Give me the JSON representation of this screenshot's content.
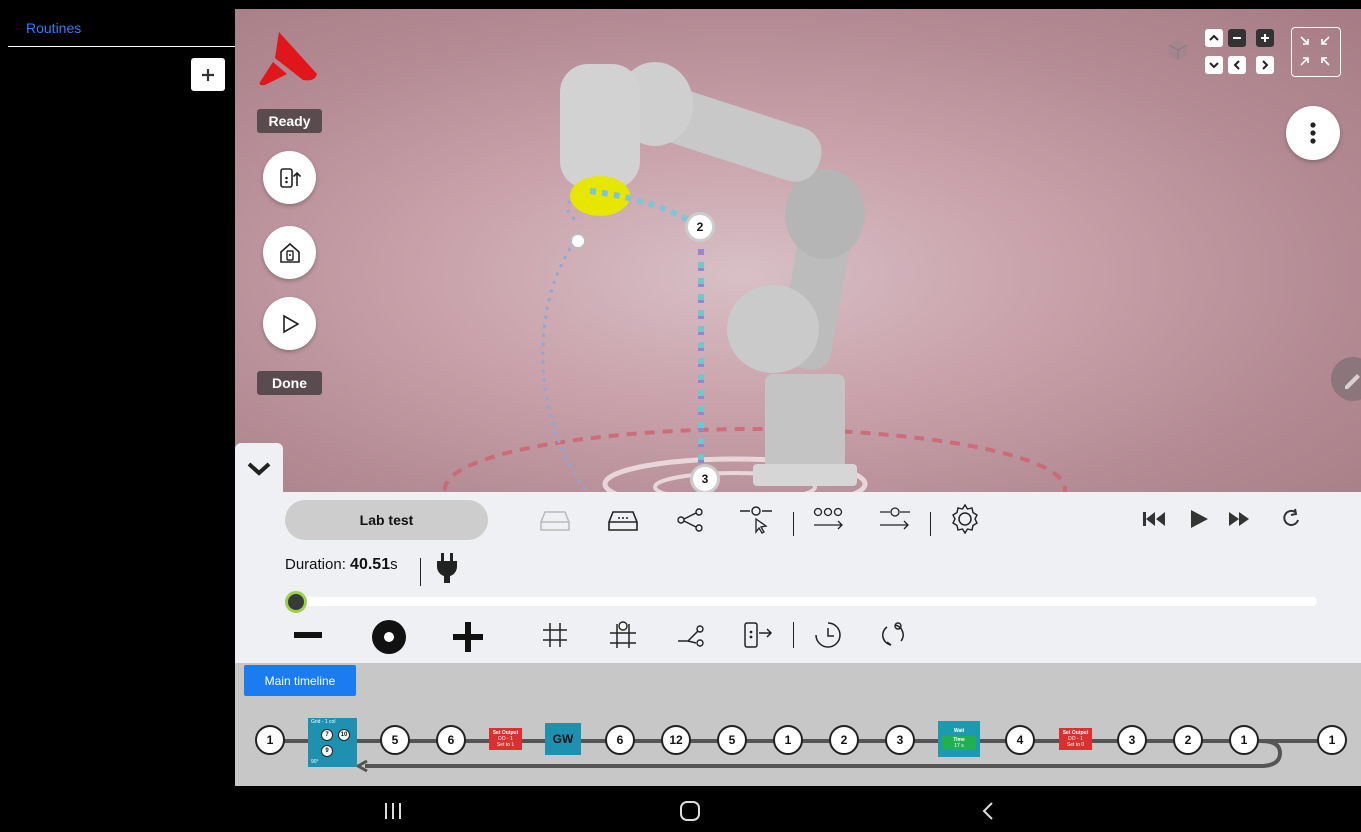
{
  "sidebar": {
    "title": "Routines"
  },
  "viewport": {
    "status_ready": "Ready",
    "status_done": "Done",
    "waypoints": [
      "2",
      "3"
    ]
  },
  "panel": {
    "routine_name": "Lab test",
    "duration_label": "Duration: ",
    "duration_value": "40.51",
    "duration_unit": "s",
    "progress": 0
  },
  "timeline": {
    "tab_label": "Main timeline",
    "grid_block": {
      "title": "Grid - 1 col",
      "nodes": [
        "7",
        "10",
        "9"
      ],
      "angle": "90°"
    },
    "set_output_1": {
      "title": "Set Output",
      "line1": "DO - 1",
      "line2": "Set to 1"
    },
    "gw_label": "GW",
    "wait_block": {
      "title": "Wait",
      "line1": "Time",
      "line2": "17 s"
    },
    "set_output_2": {
      "title": "Set Output",
      "line1": "DO - 1",
      "line2": "Set to 0"
    },
    "nodes": {
      "n1": "1",
      "n5a": "5",
      "n6a": "6",
      "n6b": "6",
      "n12": "12",
      "n5b": "5",
      "n1b": "1",
      "n2a": "2",
      "n3a": "3",
      "n4": "4",
      "n3b": "3",
      "n2b": "2",
      "n1c": "1",
      "n1d": "1"
    }
  },
  "colors": {
    "accent": "#1a7cf0",
    "set_output": "#d93030",
    "gw": "#1e90b0",
    "wait": "#1e9ab0",
    "wait_inner": "#20b050",
    "logo": "#e0161b"
  }
}
